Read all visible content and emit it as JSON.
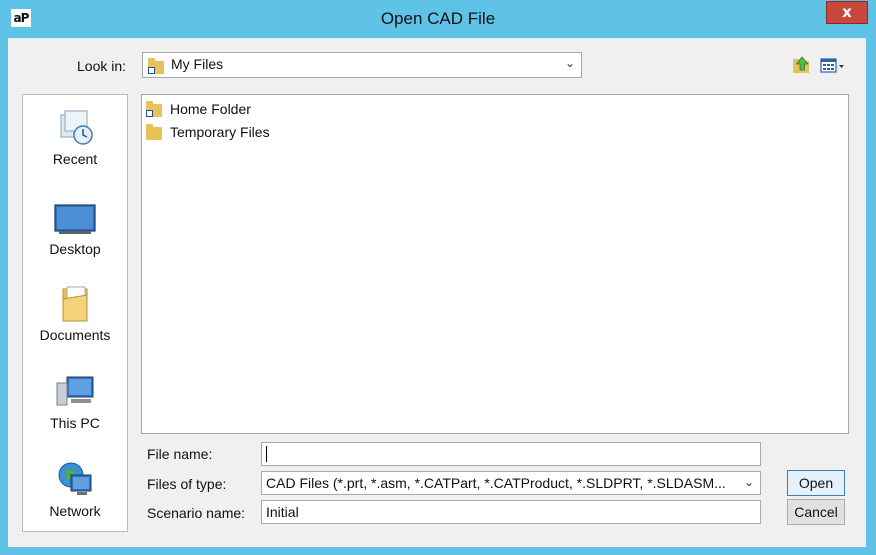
{
  "window": {
    "title": "Open CAD File",
    "app_icon_text": "aP",
    "close_label": "x"
  },
  "lookin": {
    "label": "Look in:",
    "value": "My Files"
  },
  "places": [
    {
      "label": "Recent",
      "icon": "recent-icon"
    },
    {
      "label": "Desktop",
      "icon": "desktop-icon"
    },
    {
      "label": "Documents",
      "icon": "documents-icon"
    },
    {
      "label": "This PC",
      "icon": "computer-icon"
    },
    {
      "label": "Network",
      "icon": "network-icon"
    }
  ],
  "files": [
    {
      "name": "Home Folder",
      "icon": "folder-shortcut-icon"
    },
    {
      "name": "Temporary Files",
      "icon": "folder-icon"
    }
  ],
  "form": {
    "file_name_label": "File name:",
    "file_name_value": "",
    "file_type_label": "Files of type:",
    "file_type_value": "CAD Files (*.prt, *.asm, *.CATPart, *.CATProduct, *.SLDPRT, *.SLDASM...",
    "scenario_label": "Scenario name:",
    "scenario_value": "Initial"
  },
  "buttons": {
    "open": "Open",
    "cancel": "Cancel"
  },
  "colors": {
    "titlebar": "#5ec3e6",
    "close": "#c9483d",
    "dialog_bg": "#f0f0f0",
    "default_button_border": "#3c7fb1"
  }
}
